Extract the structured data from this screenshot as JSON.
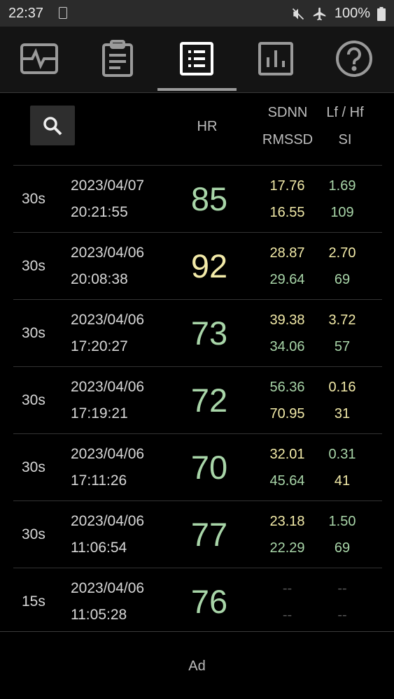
{
  "status": {
    "time": "22:37",
    "battery_text": "100%"
  },
  "tabs": [
    {
      "icon": "heart-monitor-icon",
      "active": false
    },
    {
      "icon": "clipboard-icon",
      "active": false
    },
    {
      "icon": "list-icon",
      "active": true
    },
    {
      "icon": "bar-chart-icon",
      "active": false
    },
    {
      "icon": "help-icon",
      "active": false
    }
  ],
  "header": {
    "hr": "HR",
    "sdnn": "SDNN",
    "rmssd": "RMSSD",
    "lfhf": "Lf / Hf",
    "si": "SI"
  },
  "colors": {
    "green": "#a8d5a8",
    "yellow": "#f2eaa8",
    "dash": "#555555"
  },
  "rows": [
    {
      "dur": "30s",
      "date": "2023/04/07",
      "time": "20:21:55",
      "hr": "85",
      "sdnn": "17.76",
      "rmssd": "16.55",
      "lfhf": "1.69",
      "si": "109",
      "hr_color": "green",
      "sdnn_color": "yellow",
      "rmssd_color": "yellow",
      "lfhf_color": "green",
      "si_color": "green"
    },
    {
      "dur": "30s",
      "date": "2023/04/06",
      "time": "20:08:38",
      "hr": "92",
      "sdnn": "28.87",
      "rmssd": "29.64",
      "lfhf": "2.70",
      "si": "69",
      "hr_color": "yellow",
      "sdnn_color": "yellow",
      "rmssd_color": "green",
      "lfhf_color": "yellow",
      "si_color": "green"
    },
    {
      "dur": "30s",
      "date": "2023/04/06",
      "time": "17:20:27",
      "hr": "73",
      "sdnn": "39.38",
      "rmssd": "34.06",
      "lfhf": "3.72",
      "si": "57",
      "hr_color": "green",
      "sdnn_color": "yellow",
      "rmssd_color": "green",
      "lfhf_color": "yellow",
      "si_color": "green"
    },
    {
      "dur": "30s",
      "date": "2023/04/06",
      "time": "17:19:21",
      "hr": "72",
      "sdnn": "56.36",
      "rmssd": "70.95",
      "lfhf": "0.16",
      "si": "31",
      "hr_color": "green",
      "sdnn_color": "green",
      "rmssd_color": "yellow",
      "lfhf_color": "yellow",
      "si_color": "yellow"
    },
    {
      "dur": "30s",
      "date": "2023/04/06",
      "time": "17:11:26",
      "hr": "70",
      "sdnn": "32.01",
      "rmssd": "45.64",
      "lfhf": "0.31",
      "si": "41",
      "hr_color": "green",
      "sdnn_color": "yellow",
      "rmssd_color": "green",
      "lfhf_color": "green",
      "si_color": "yellow"
    },
    {
      "dur": "30s",
      "date": "2023/04/06",
      "time": "11:06:54",
      "hr": "77",
      "sdnn": "23.18",
      "rmssd": "22.29",
      "lfhf": "1.50",
      "si": "69",
      "hr_color": "green",
      "sdnn_color": "yellow",
      "rmssd_color": "green",
      "lfhf_color": "green",
      "si_color": "green"
    },
    {
      "dur": "15s",
      "date": "2023/04/06",
      "time": "11:05:28",
      "hr": "76",
      "sdnn": "--",
      "rmssd": "--",
      "lfhf": "--",
      "si": "--",
      "hr_color": "green",
      "sdnn_color": "dash",
      "rmssd_color": "dash",
      "lfhf_color": "dash",
      "si_color": "dash"
    }
  ],
  "ad_label": "Ad"
}
